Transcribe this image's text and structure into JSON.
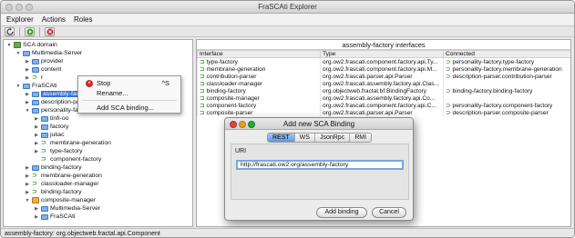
{
  "window": {
    "title": "FraSCAti Explorer"
  },
  "menu": [
    "Explorer",
    "Actions",
    "Roles"
  ],
  "tree": [
    {
      "label": "SCA domain",
      "indent": 0,
      "expand": "open",
      "icon": "domain-icon"
    },
    {
      "label": "Multimedia-Server",
      "indent": 1,
      "expand": "open",
      "icon": "folder-icon"
    },
    {
      "label": "provider",
      "indent": 2,
      "expand": "closed",
      "icon": "folder-icon"
    },
    {
      "label": "content",
      "indent": 2,
      "expand": "closed",
      "icon": "folder-icon"
    },
    {
      "label": "r",
      "indent": 2,
      "expand": "closed",
      "icon": "arrow-icon"
    },
    {
      "label": "FraSCAti",
      "indent": 1,
      "expand": "open",
      "icon": "folder-icon"
    },
    {
      "label": "assembly-factory",
      "indent": 2,
      "expand": "closed",
      "icon": "folder-icon",
      "selected": true
    },
    {
      "label": "description-parser",
      "indent": 2,
      "expand": "closed",
      "icon": "folder-icon"
    },
    {
      "label": "personality-factory",
      "indent": 2,
      "expand": "open",
      "icon": "folder-icon"
    },
    {
      "label": "tinfi-oo",
      "indent": 3,
      "expand": "closed",
      "icon": "folder-icon"
    },
    {
      "label": "factory",
      "indent": 3,
      "expand": "closed",
      "icon": "folder-icon"
    },
    {
      "label": "juliac",
      "indent": 3,
      "expand": "closed",
      "icon": "folder-icon"
    },
    {
      "label": "membrane-generation",
      "indent": 3,
      "expand": "closed",
      "icon": "arrow-icon"
    },
    {
      "label": "type-factory",
      "indent": 3,
      "expand": "closed",
      "icon": "arrow-icon"
    },
    {
      "label": "component-factory",
      "indent": 3,
      "expand": "none",
      "icon": "arrow-icon"
    },
    {
      "label": "binding-factory",
      "indent": 2,
      "expand": "closed",
      "icon": "folder-icon"
    },
    {
      "label": "membrane-generation",
      "indent": 2,
      "expand": "closed",
      "icon": "arrow-icon"
    },
    {
      "label": "classloader-manager",
      "indent": 2,
      "expand": "closed",
      "icon": "arrow-icon"
    },
    {
      "label": "binding-factory",
      "indent": 2,
      "expand": "closed",
      "icon": "arrow-icon"
    },
    {
      "label": "composite-manager",
      "indent": 2,
      "expand": "open",
      "icon": "component-icon"
    },
    {
      "label": "Multimedia-Server",
      "indent": 3,
      "expand": "closed",
      "icon": "folder-icon"
    },
    {
      "label": "FraSCAti",
      "indent": 3,
      "expand": "closed",
      "icon": "folder-icon"
    }
  ],
  "context_menu": {
    "stop": "Stop",
    "stop_shortcut": "^S",
    "rename": "Rename...",
    "add_binding": "Add SCA binding..."
  },
  "interfaces_panel": {
    "title": "assembly-factory interfaces",
    "columns": [
      "Interface",
      "Type",
      "Connected"
    ],
    "rows": [
      {
        "interface": "type-factory",
        "type": "org.ow2.frascati.component.factory.api.Ty...",
        "connected": "personality-factory.type-factory"
      },
      {
        "interface": "membrane-generation",
        "type": "org.ow2.frascati.component.factory.api.M...",
        "connected": "personality-factory.membrane-generation"
      },
      {
        "interface": "contribution-parser",
        "type": "org.ow2.frascati.parser.api.Parser",
        "connected": "description-parser.contribution-parser"
      },
      {
        "interface": "classloader-manager",
        "type": "org.ow2.frascati.assembly.factory.api.Clas...",
        "connected": ""
      },
      {
        "interface": "binding-factory",
        "type": "org.objectweb.fractal.bf.BindingFactory",
        "connected": "binding-factory.binding-factory"
      },
      {
        "interface": "composite-manager",
        "type": "org.ow2.frascati.assembly.factory.api.Co...",
        "connected": ""
      },
      {
        "interface": "component-factory",
        "type": "org.ow2.frascati.component.factory.api.C...",
        "connected": "personality-factory.component-factory"
      },
      {
        "interface": "composite-parser",
        "type": "org.ow2.frascati.parser.api.Parser",
        "connected": "description-parser.composite-parser"
      }
    ]
  },
  "dialog": {
    "title": "Add new SCA Binding",
    "tabs": [
      "REST",
      "WS",
      "JsonRpc",
      "RMI"
    ],
    "active_tab": "REST",
    "uri_label": "URI",
    "uri_value": "http://frascati.ow2.org/assembly-factory",
    "add_button": "Add binding",
    "cancel_button": "Cancel"
  },
  "status": "assembly-factory: org.objectweb.fractal.api.Component",
  "colors": {
    "selection": "#3875d7",
    "connected_arrow": "#3c9b2a",
    "stop_icon": "#c62b2b"
  }
}
